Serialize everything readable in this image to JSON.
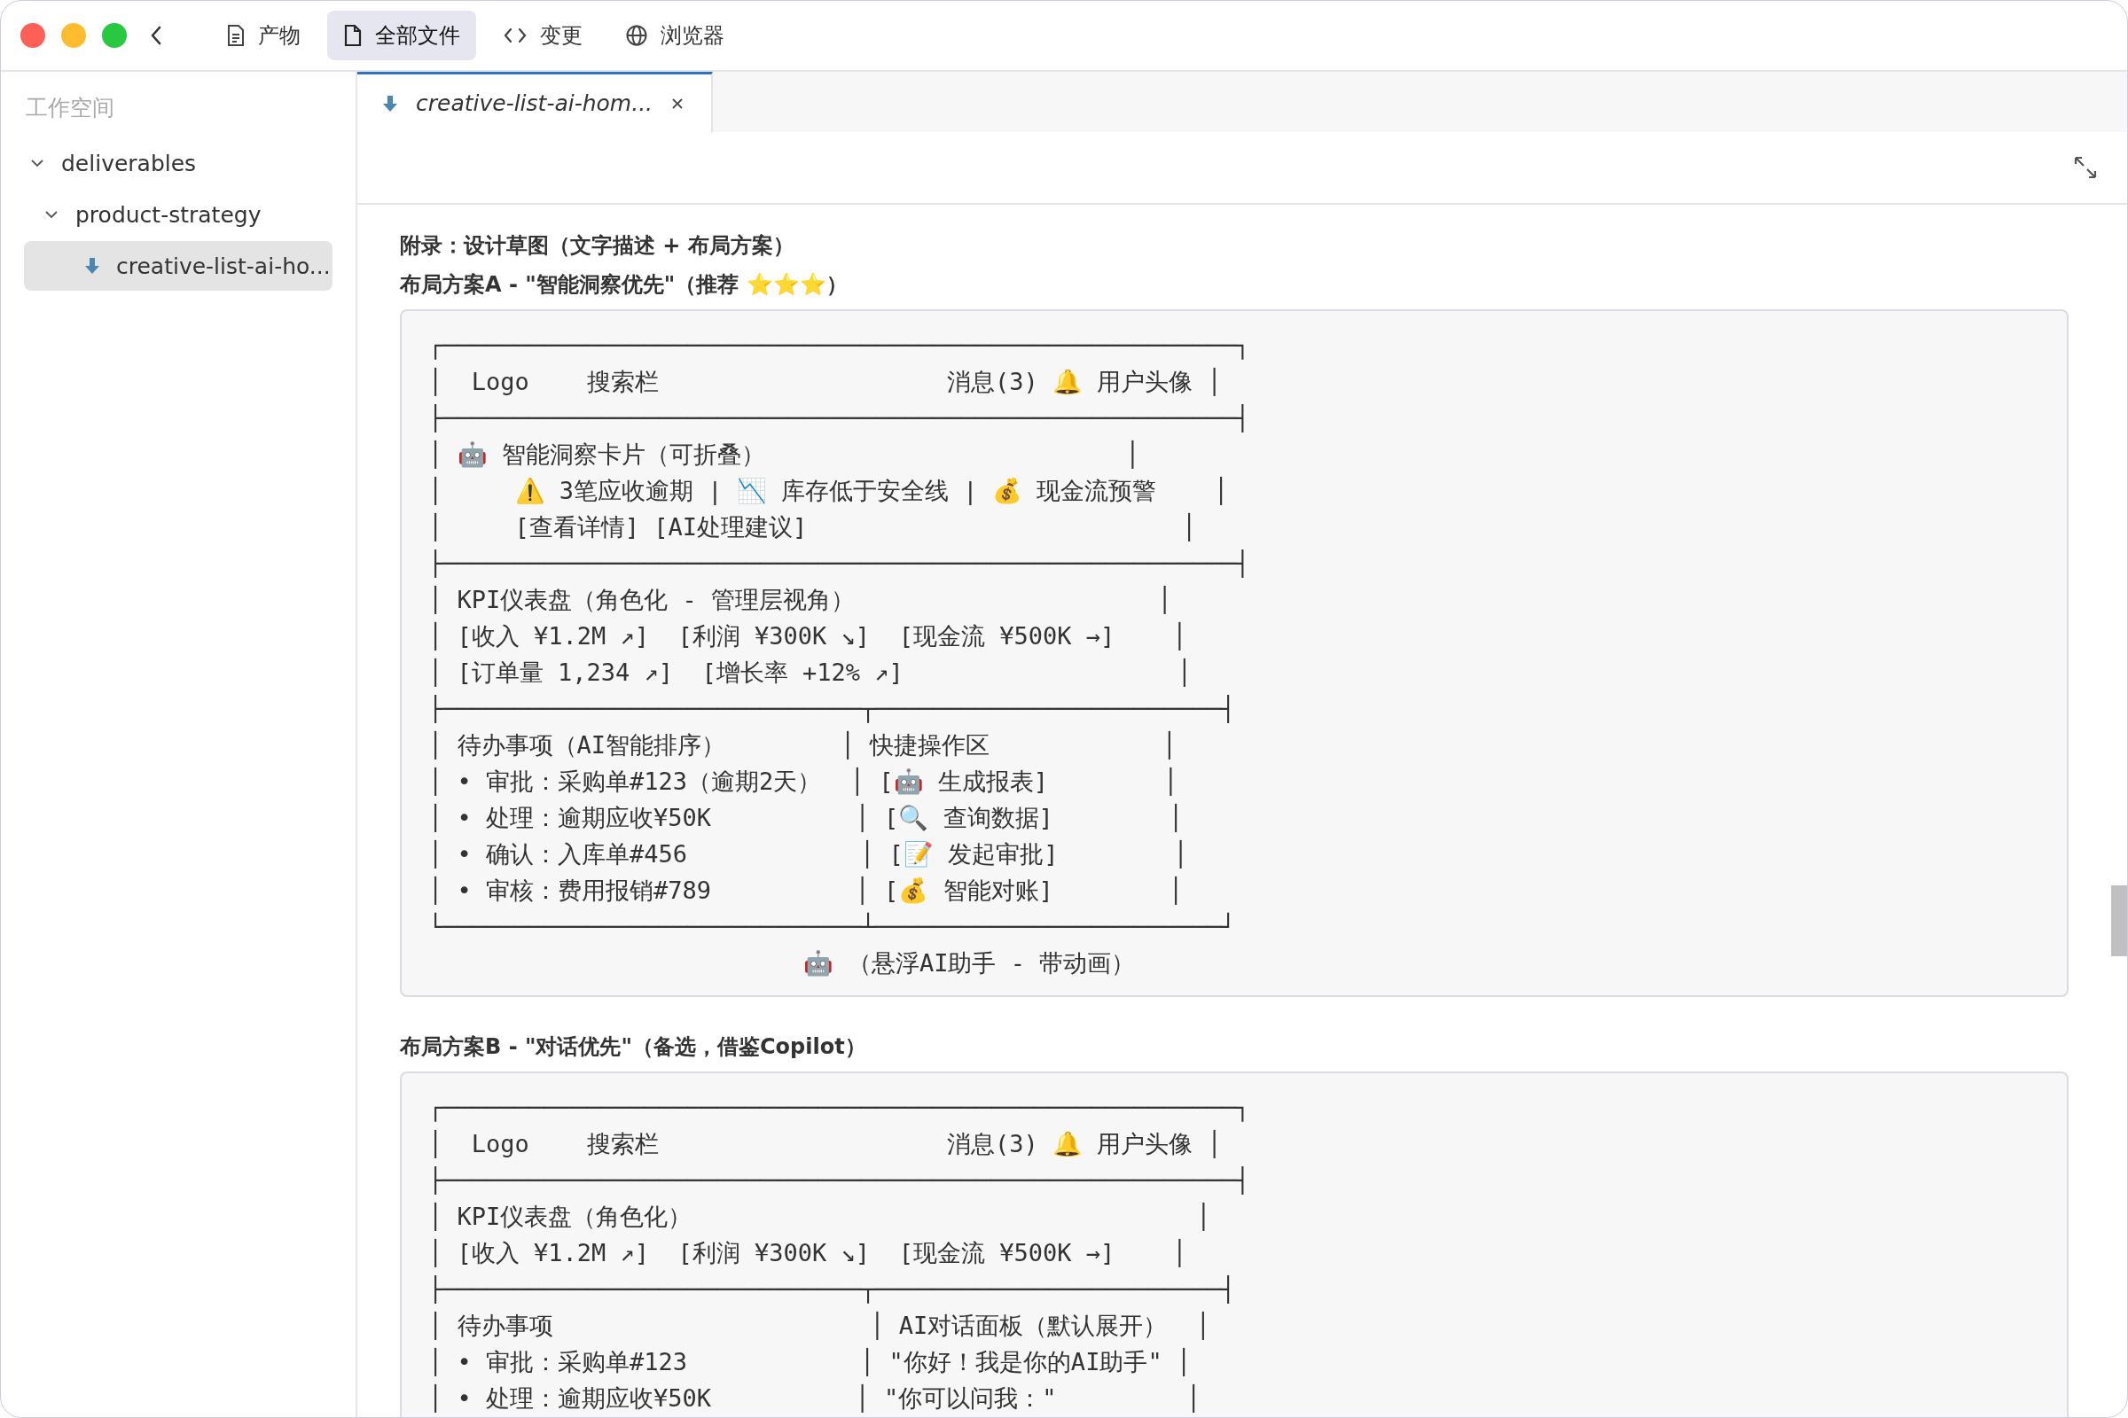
{
  "toolbar": {
    "tabs": [
      {
        "label": "产物",
        "selected": false
      },
      {
        "label": "全部文件",
        "selected": true
      },
      {
        "label": "变更",
        "selected": false
      },
      {
        "label": "浏览器",
        "selected": false
      }
    ]
  },
  "sidebar": {
    "title": "工作空间",
    "tree": [
      {
        "label": "deliverables",
        "expanded": true,
        "children": [
          {
            "label": "product-strategy",
            "expanded": true,
            "children": [
              {
                "label": "creative-list-ai-ho...",
                "selected": true
              }
            ]
          }
        ]
      }
    ]
  },
  "editor": {
    "tabs": [
      {
        "label": "creative-list-ai-hom...",
        "selected": true
      }
    ],
    "content": [
      {
        "kind": "heading",
        "text": "附录：设计草图（文字描述 + 布局方案）"
      },
      {
        "kind": "heading",
        "text": "布局方案A - \"智能洞察优先\"（推荐 ⭐⭐⭐）"
      },
      {
        "kind": "code",
        "lines": [
          "┌───────────────────────────────────────────────────────┐",
          "│  Logo    搜索栏                    消息(3) 🔔 用户头像 │",
          "├───────────────────────────────────────────────────────┤",
          "│ 🤖 智能洞察卡片（可折叠）                         │",
          "│     ⚠️ 3笔应收逾期 | 📉 库存低于安全线 | 💰 现金流预警    │",
          "│     [查看详情] [AI处理建议]                          │",
          "├───────────────────────────────────────────────────────┤",
          "│ KPI仪表盘（角色化 - 管理层视角）                     │",
          "│ [收入 ¥1.2M ↗]  [利润 ¥300K ↘]  [现金流 ¥500K →]    │",
          "│ [订单量 1,234 ↗]  [增长率 +12% ↗]                   │",
          "├─────────────────────────────┬────────────────────────┤",
          "│ 待办事项（AI智能排序）        │ 快捷操作区            │",
          "│ • 审批：采购单#123（逾期2天）  │ [🤖 生成报表]        │",
          "│ • 处理：逾期应收¥50K          │ [🔍 查询数据]        │",
          "│ • 确认：入库单#456            │ [📝 发起审批]        │",
          "│ • 审核：费用报销#789          │ [💰 智能对账]        │",
          "└─────────────────────────────┴────────────────────────┘",
          "                          🤖 （悬浮AI助手 - 带动画）"
        ]
      },
      {
        "kind": "heading",
        "text": "布局方案B - \"对话优先\"（备选，借鉴Copilot）"
      },
      {
        "kind": "code",
        "lines": [
          "┌───────────────────────────────────────────────────────┐",
          "│  Logo    搜索栏                    消息(3) 🔔 用户头像 │",
          "├───────────────────────────────────────────────────────┤",
          "│ KPI仪表盘（角色化）                                   │",
          "│ [收入 ¥1.2M ↗]  [利润 ¥300K ↘]  [现金流 ¥500K →]    │",
          "├─────────────────────────────┬────────────────────────┤",
          "│ 待办事项                      │ AI对话面板（默认展开）  │",
          "│ • 审批：采购单#123            │ \"你好！我是你的AI助手\" │",
          "│ • 处理：逾期应收¥50K          │ \"你可以问我：\"         │"
        ]
      }
    ]
  }
}
